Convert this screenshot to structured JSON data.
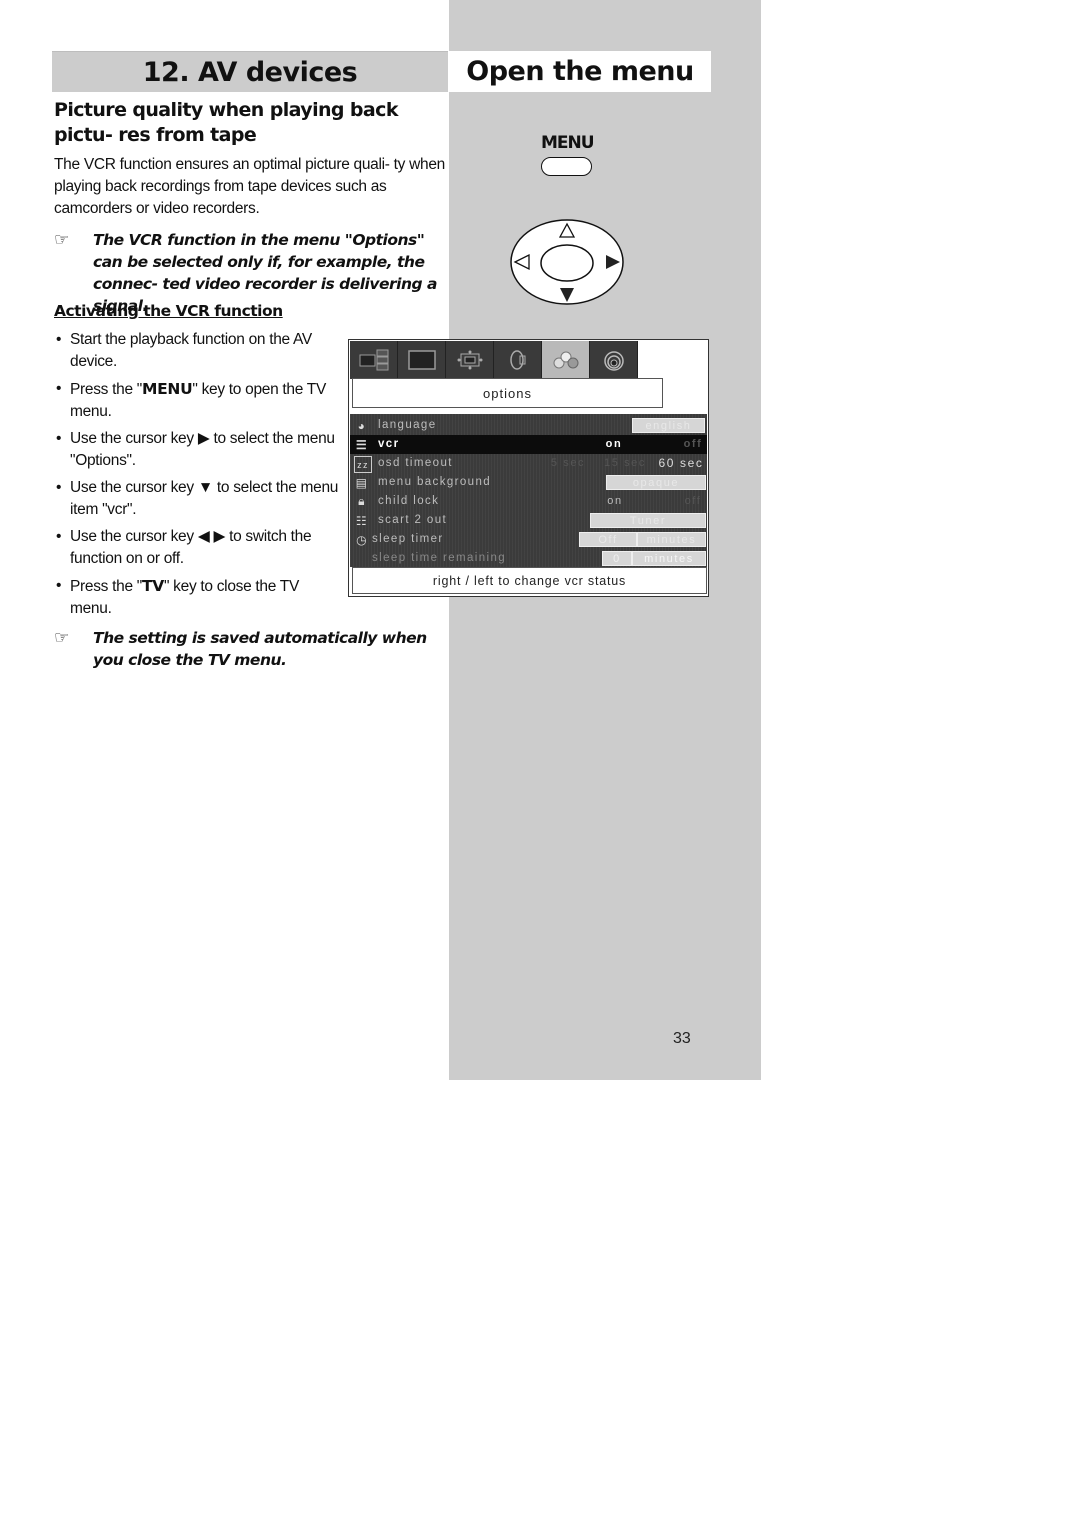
{
  "header": {
    "left_title": "12. AV devices",
    "right_title": "Open the menu"
  },
  "section": {
    "heading": "Picture quality when playing back pictu- res from tape",
    "intro": "The VCR function ensures an optimal picture quali- ty when playing back recordings from tape devices such as camcorders or video recorders.",
    "note1": "The VCR function in the menu \"Options\" can be selected only if, for example, the connec- ted video recorder is delivering a signal.",
    "subheading": "Activating the VCR function",
    "steps": [
      {
        "pre": "Start the playback function on the AV device.",
        "key": "",
        "post": ""
      },
      {
        "pre": "Press the \"",
        "key": "MENU",
        "post": "\" key to open the TV menu."
      },
      {
        "pre": "Use the cursor key ▶ to select the menu \"Options\".",
        "key": "",
        "post": ""
      },
      {
        "pre": "Use the cursor key ▼ to select the menu item \"vcr\".",
        "key": "",
        "post": ""
      },
      {
        "pre": "Use the cursor key ◀ ▶ to switch the function on or off.",
        "key": "",
        "post": ""
      },
      {
        "pre": "Press the \"",
        "key": "TV",
        "post": "\" key to close the TV menu."
      }
    ],
    "note2": "The setting is saved automatically when you close the TV menu.",
    "note_icon": "☞"
  },
  "remote": {
    "menu_label": "MENU",
    "icons": [
      "menu-button",
      "dpad-up-outline",
      "dpad-left-outline",
      "dpad-right-filled",
      "dpad-down-filled",
      "dpad-ok"
    ]
  },
  "osd": {
    "tabs": [
      {
        "name": "picture-in-picture",
        "active": false
      },
      {
        "name": "screen",
        "active": false
      },
      {
        "name": "picture-format",
        "active": false
      },
      {
        "name": "sound",
        "active": false
      },
      {
        "name": "options",
        "active": true
      },
      {
        "name": "channels",
        "active": false
      }
    ],
    "title": "options",
    "rows": [
      {
        "label": "language",
        "icon": "globe",
        "values": [
          "english"
        ]
      },
      {
        "label": "vcr",
        "icon": "tape",
        "values": [
          "on",
          "off"
        ],
        "selected": true
      },
      {
        "label": "osd timeout",
        "icon": "zz",
        "values": [
          "5 sec",
          "15 sec",
          "60 sec"
        ]
      },
      {
        "label": "menu background",
        "icon": "panel",
        "values": [
          "opaque"
        ]
      },
      {
        "label": "child lock",
        "icon": "lock",
        "values": [
          "on",
          "off"
        ]
      },
      {
        "label": "scart 2 out",
        "icon": "scart",
        "values": [
          "Tuner"
        ]
      },
      {
        "label": "sleep timer",
        "icon": "clock",
        "values": [
          "Off",
          "minutes"
        ]
      },
      {
        "label": "sleep time remaining",
        "icon": "",
        "values": [
          "0",
          "minutes"
        ]
      }
    ],
    "help": "right /  left to change vcr status"
  },
  "page_number": "33"
}
